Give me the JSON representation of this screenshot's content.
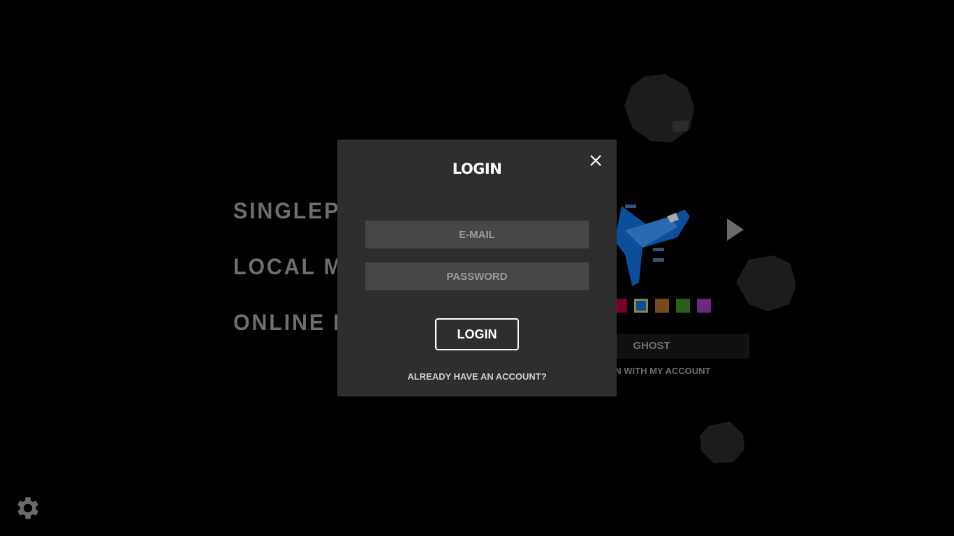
{
  "menu": {
    "items": [
      "SINGLEPLAYER",
      "LOCAL MULTIPLAYER",
      "ONLINE MULTIPLAYER"
    ]
  },
  "ship_select": {
    "colors": [
      "#7a0028",
      "#0b4f9a",
      "#7a4a1d",
      "#2a5f1a",
      "#6a2a80"
    ],
    "selected_index": 1,
    "name_value": "GHOST",
    "account_link": "LOGIN WITH MY ACCOUNT"
  },
  "modal": {
    "title": "LOGIN",
    "email_placeholder": "E-MAIL",
    "password_placeholder": "PASSWORD",
    "submit_label": "LOGIN",
    "account_link": "ALREADY HAVE AN ACCOUNT?"
  }
}
